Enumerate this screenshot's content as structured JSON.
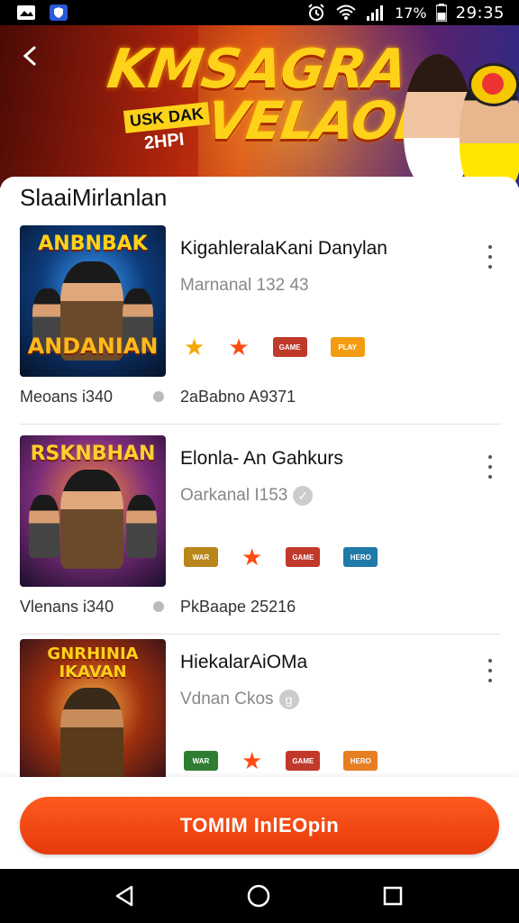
{
  "status_bar": {
    "battery": "17%",
    "time": "29:35"
  },
  "hero": {
    "title_line1": "KMSAGRA",
    "title_line2": "VELAON",
    "sub_line1": "USK DAK",
    "sub_line2": "2HPI"
  },
  "section": {
    "title": "SlaaiMirlanlan"
  },
  "cards": [
    {
      "thumb_title": "ANBNBAK",
      "thumb_title2": "ANDANIAN",
      "name": "KigahleralaKani Danylan",
      "subtitle": "Marnanal 132 43",
      "meta_left": "Meoans i340",
      "meta_right": "2aBabno A9371",
      "badges": [
        "star-gold",
        "star",
        "logo",
        "logo"
      ]
    },
    {
      "thumb_title": "RSKNBHAN",
      "thumb_title2": "",
      "name": "Elonla- An Gahkurs",
      "subtitle": "Oarkanal I153",
      "meta_left": "Vlenans i340",
      "meta_right": "PkBaape 25216",
      "badges": [
        "logo",
        "star",
        "logo",
        "logo"
      ]
    },
    {
      "thumb_title": "GNRHINIA",
      "thumb_title2": "IKAVAN",
      "name": "HiekalarAiOMa",
      "subtitle": "Vdnan Ckos",
      "meta_left": "",
      "meta_right": "",
      "badges": [
        "logo",
        "star",
        "logo",
        "logo"
      ]
    }
  ],
  "cta": {
    "label": "TOMIM InlEOpin"
  },
  "colors": {
    "accent": "#f04a12",
    "star": "#ff4a12",
    "star_gold": "#f5a800"
  }
}
